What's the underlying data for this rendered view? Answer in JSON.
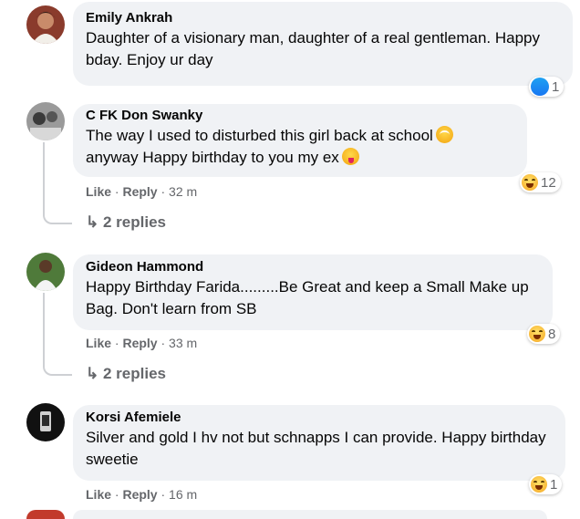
{
  "colors": {
    "bubble": "#f0f2f5",
    "meta": "#65676b",
    "thread_line": "#ced0d4",
    "like_blue": "#1877f2"
  },
  "comments": [
    {
      "author": "Emily Ankrah",
      "text": "Daughter of a visionary man, daughter of a real gentleman. Happy bday. Enjoy ur day",
      "reaction_icon": "like-icon",
      "reaction_count": "1"
    },
    {
      "author": "C FK Don Swanky",
      "text_line1": "The way I used to disturbed this girl back at school",
      "text_line2": "anyway Happy birthday to you my ex",
      "reaction_icon": "haha-icon",
      "reaction_count": "12",
      "like_label": "Like",
      "reply_label": "Reply",
      "time": "32 m",
      "replies": "2 replies"
    },
    {
      "author": "Gideon Hammond",
      "text": "Happy Birthday Farida.........Be Great and keep a Small Make up Bag. Don't learn from SB",
      "reaction_icon": "haha-icon",
      "reaction_count": "8",
      "like_label": "Like",
      "reply_label": "Reply",
      "time": "33 m",
      "replies": "2 replies"
    },
    {
      "author": "Korsi Afemiele",
      "text": "Silver and gold I hv not but schnapps I can provide. Happy birthday sweetie",
      "reaction_icon": "haha-icon",
      "reaction_count": "1",
      "like_label": "Like",
      "reply_label": "Reply",
      "time": "16 m"
    }
  ]
}
